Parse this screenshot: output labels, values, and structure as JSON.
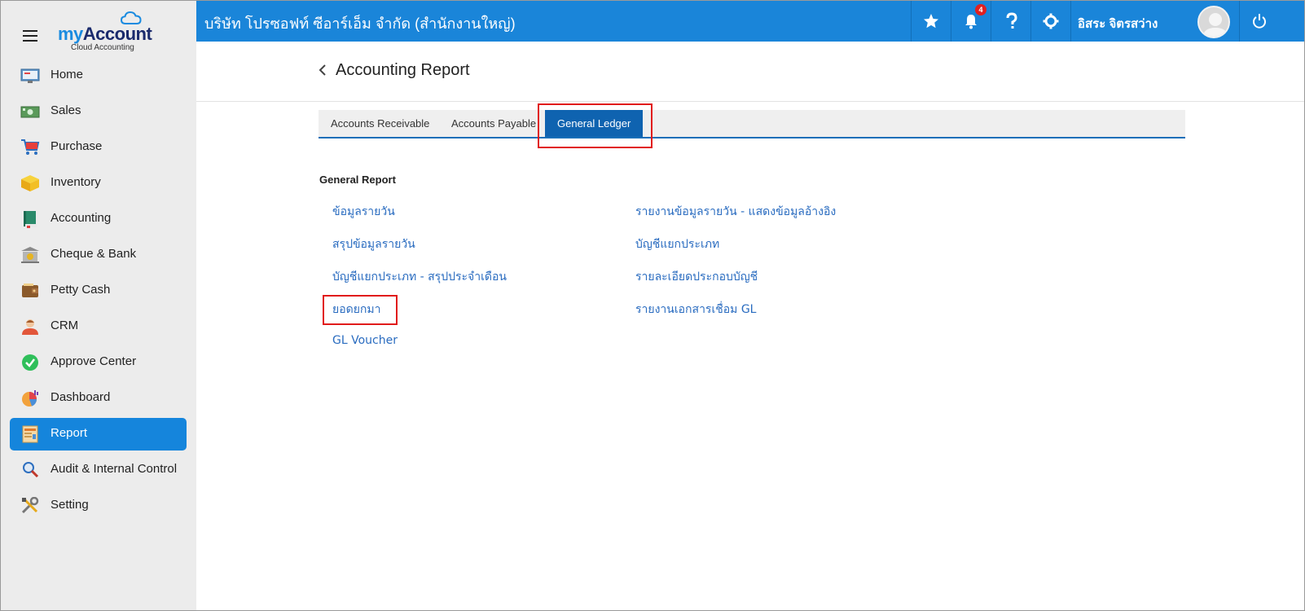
{
  "brand": {
    "logo_my": "my",
    "logo_account": "Account",
    "logo_sub": "Cloud Accounting"
  },
  "sidebar": {
    "items": [
      {
        "label": "Home",
        "icon": "home-icon"
      },
      {
        "label": "Sales",
        "icon": "sales-icon"
      },
      {
        "label": "Purchase",
        "icon": "cart-icon"
      },
      {
        "label": "Inventory",
        "icon": "box-icon"
      },
      {
        "label": "Accounting",
        "icon": "book-icon"
      },
      {
        "label": "Cheque & Bank",
        "icon": "bank-icon"
      },
      {
        "label": "Petty Cash",
        "icon": "wallet-icon"
      },
      {
        "label": "CRM",
        "icon": "people-icon"
      },
      {
        "label": "Approve Center",
        "icon": "check-icon"
      },
      {
        "label": "Dashboard",
        "icon": "pie-chart-icon"
      },
      {
        "label": "Report",
        "icon": "report-icon",
        "active": true
      },
      {
        "label": "Audit & Internal Control",
        "icon": "magnifier-icon"
      },
      {
        "label": "Setting",
        "icon": "tools-icon"
      }
    ]
  },
  "topbar": {
    "company": "บริษัท โปรซอฟท์ ซีอาร์เอ็ม จำกัด (สำนักงานใหญ่)",
    "notification_count": "4",
    "user_name": "อิสระ จิตรสว่าง"
  },
  "header": {
    "title": "Accounting Report"
  },
  "tabs": [
    {
      "label": "Accounts Receivable"
    },
    {
      "label": "Accounts Payable"
    },
    {
      "label": "General Ledger",
      "active": true
    }
  ],
  "section": {
    "title": "General Report"
  },
  "reports": {
    "left": [
      "ข้อมูลรายวัน",
      "สรุปข้อมูลรายวัน",
      "บัญชีแยกประเภท - สรุปประจำเดือน",
      "ยอดยกมา",
      "GL Voucher"
    ],
    "right": [
      "รายงานข้อมูลรายวัน - แสดงข้อมูลอ้างอิง",
      "บัญชีแยกประเภท",
      "รายละเอียดประกอบบัญชี",
      "รายงานเอกสารเชื่อม GL"
    ]
  },
  "colors": {
    "topbar": "#1a85d9",
    "sidebar_bg": "#ececec",
    "active_nav": "#1585dc",
    "active_tab": "#0f63b0",
    "link": "#2a6cc0",
    "highlight_box": "#e11b1b"
  }
}
